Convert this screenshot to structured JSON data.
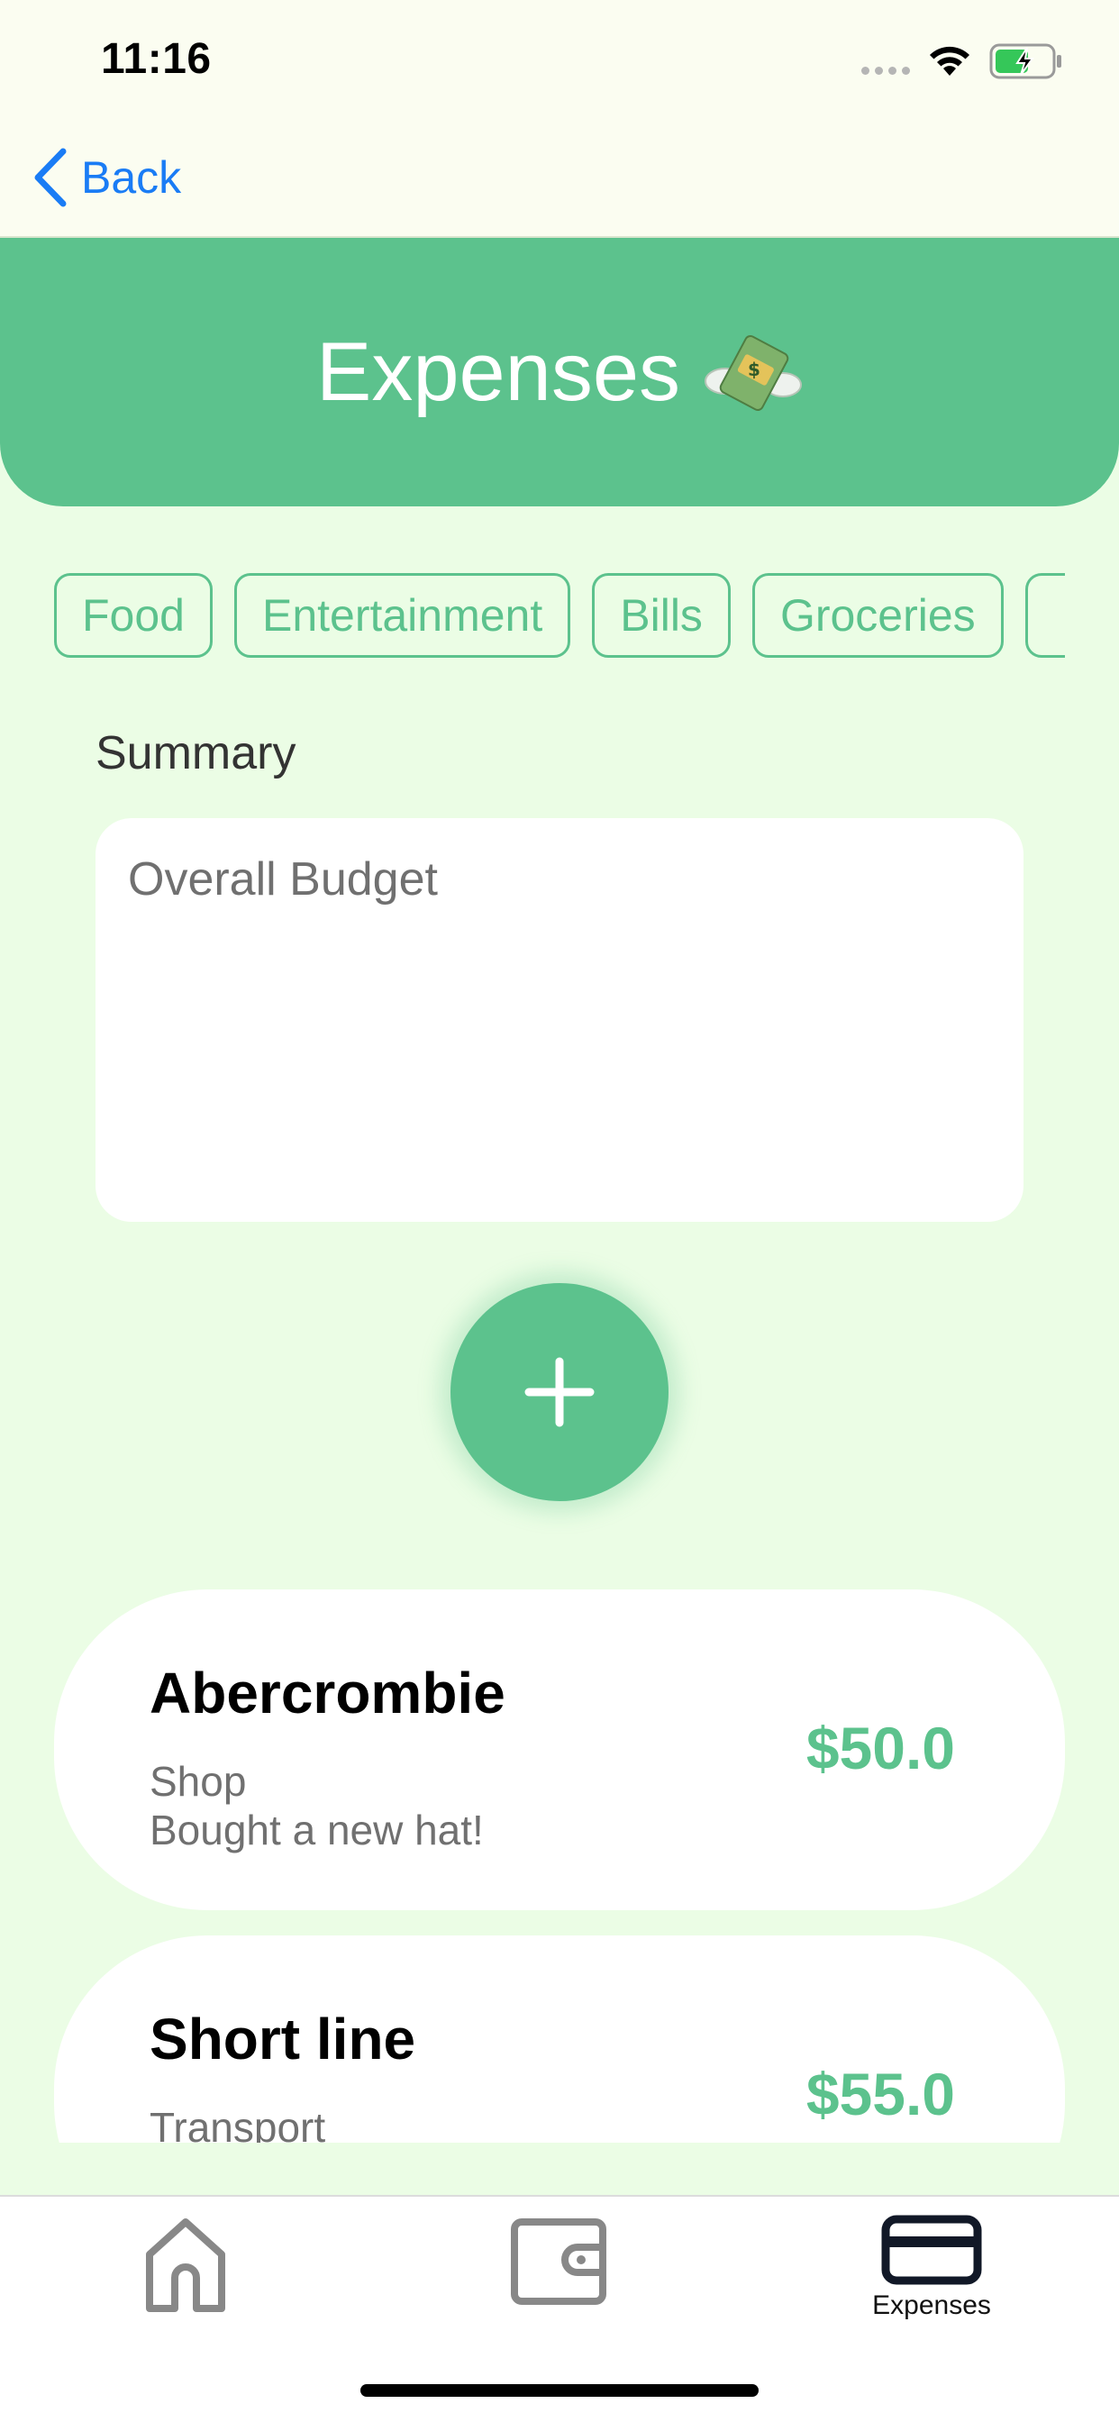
{
  "status_bar": {
    "time": "11:16"
  },
  "nav": {
    "back_label": "Back"
  },
  "header": {
    "title": "Expenses",
    "emoji": "💸"
  },
  "categories": [
    "Food",
    "Entertainment",
    "Bills",
    "Groceries",
    ""
  ],
  "summary": {
    "label": "Summary",
    "card_title": "Overall Budget"
  },
  "add_button": {
    "icon": "plus-icon"
  },
  "expenses": [
    {
      "name": "Abercrombie",
      "category": "Shop",
      "description": "Bought a new hat!",
      "amount": "$50.0"
    },
    {
      "name": "Short line",
      "category": "Transport",
      "description": "",
      "amount": "$55.0"
    }
  ],
  "tab_bar": {
    "items": [
      {
        "icon": "home-icon",
        "label": ""
      },
      {
        "icon": "wallet-icon",
        "label": ""
      },
      {
        "icon": "credit-card-icon",
        "label": "Expenses"
      }
    ]
  },
  "colors": {
    "accent": "#5cc28d",
    "background": "#ebfde5",
    "link": "#1a7cf5"
  }
}
